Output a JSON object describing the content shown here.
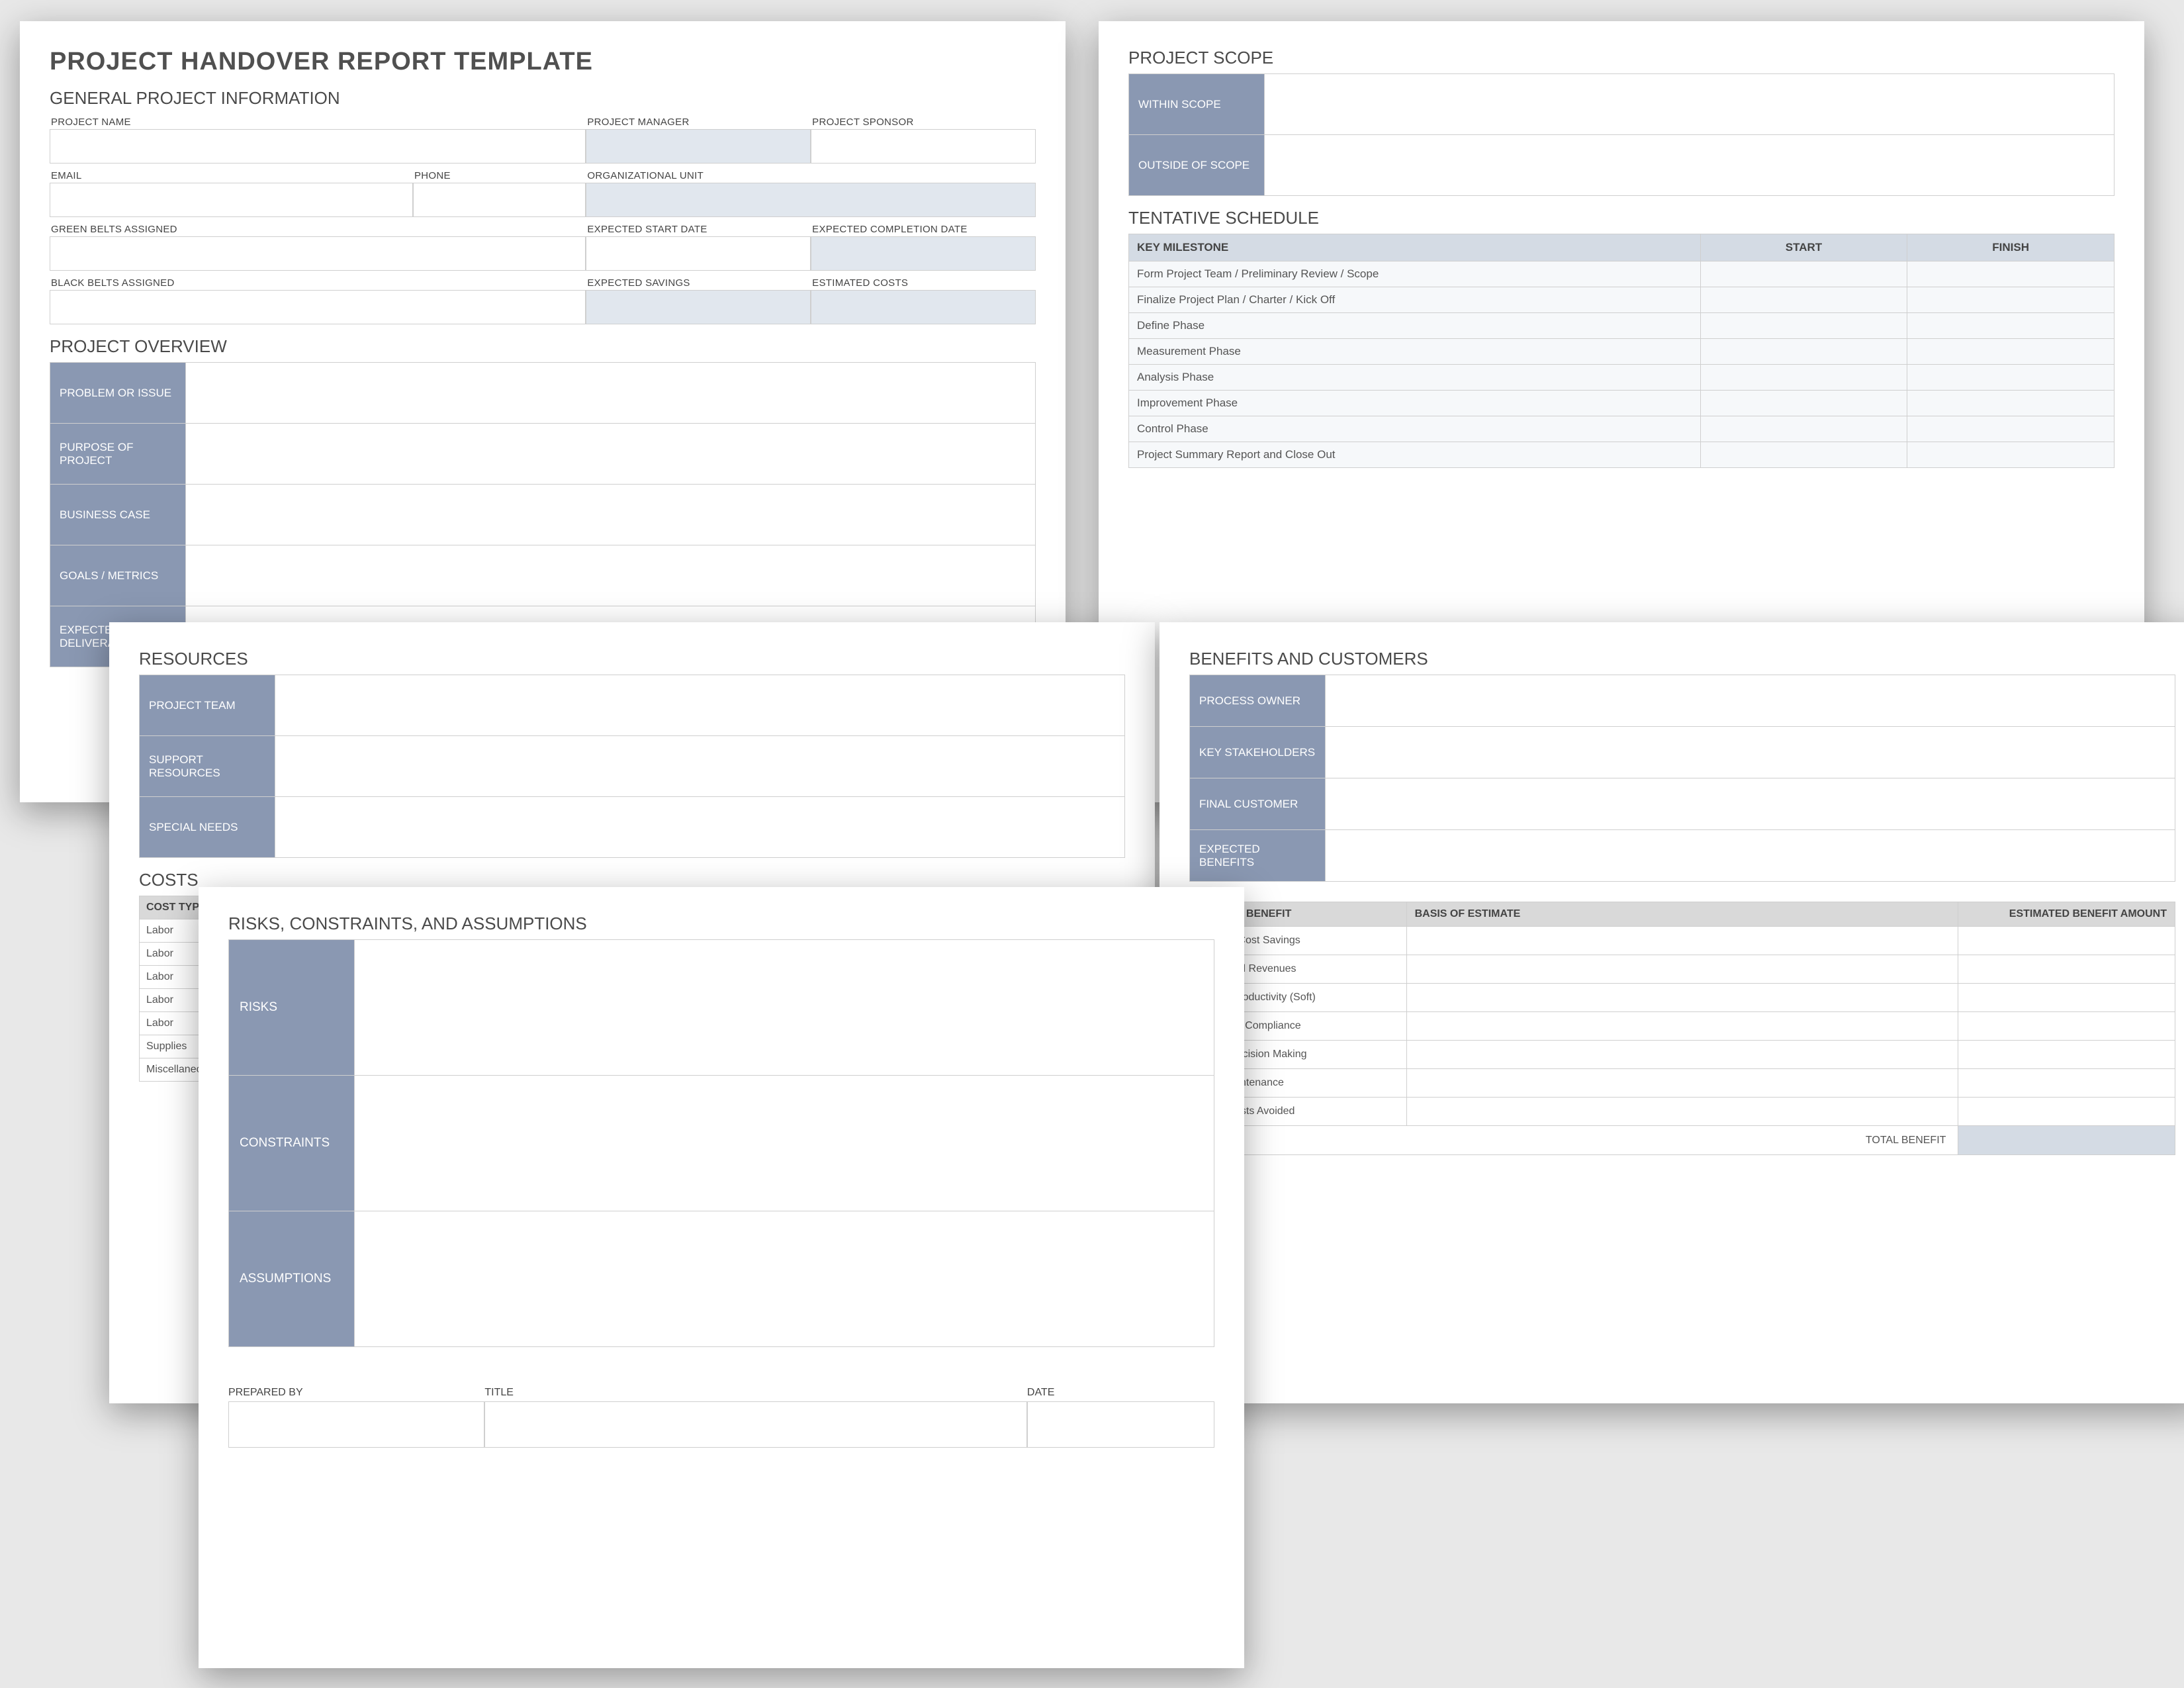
{
  "main_title": "PROJECT HANDOVER REPORT TEMPLATE",
  "sections": {
    "general_info": "GENERAL PROJECT INFORMATION",
    "project_overview": "PROJECT OVERVIEW",
    "project_scope": "PROJECT SCOPE",
    "tentative_schedule": "TENTATIVE SCHEDULE",
    "resources": "RESOURCES",
    "costs": "COSTS",
    "benefits_customers": "BENEFITS AND CUSTOMERS",
    "risks": "RISKS, CONSTRAINTS, AND ASSUMPTIONS"
  },
  "fields": {
    "project_name": "PROJECT NAME",
    "project_manager": "PROJECT MANAGER",
    "project_sponsor": "PROJECT SPONSOR",
    "email": "EMAIL",
    "phone": "PHONE",
    "org_unit": "ORGANIZATIONAL UNIT",
    "green_belts": "GREEN BELTS ASSIGNED",
    "expected_start": "EXPECTED START DATE",
    "expected_completion": "EXPECTED COMPLETION DATE",
    "black_belts": "BLACK BELTS ASSIGNED",
    "expected_savings": "EXPECTED SAVINGS",
    "estimated_costs": "ESTIMATED COSTS"
  },
  "overview_rows": [
    "PROBLEM OR ISSUE",
    "PURPOSE OF PROJECT",
    "BUSINESS CASE",
    "GOALS / METRICS",
    "EXPECTED DELIVERABLES"
  ],
  "scope_rows": [
    "WITHIN SCOPE",
    "OUTSIDE OF SCOPE"
  ],
  "schedule": {
    "headers": {
      "milestone": "KEY MILESTONE",
      "start": "START",
      "finish": "FINISH"
    },
    "rows": [
      "Form Project Team / Preliminary Review / Scope",
      "Finalize Project Plan / Charter / Kick Off",
      "Define Phase",
      "Measurement Phase",
      "Analysis Phase",
      "Improvement Phase",
      "Control Phase",
      "Project Summary Report and Close Out"
    ]
  },
  "resources_rows": [
    "PROJECT TEAM",
    "SUPPORT RESOURCES",
    "SPECIAL NEEDS"
  ],
  "costs": {
    "header": "COST TYPE",
    "rows": [
      "Labor",
      "Labor",
      "Labor",
      "Labor",
      "Labor",
      "Supplies",
      "Miscellaneous"
    ]
  },
  "benefits_rows": [
    "PROCESS OWNER",
    "KEY STAKEHOLDERS",
    "FINAL CUSTOMER",
    "EXPECTED BENEFITS"
  ],
  "benefit_table": {
    "headers": {
      "type": "TYPE OF BENEFIT",
      "basis": "BASIS OF ESTIMATE",
      "amount": "ESTIMATED BENEFIT AMOUNT"
    },
    "rows": [
      "Specific Cost Savings",
      "Enhanced Revenues",
      "Higher Productivity (Soft)",
      "Improved Compliance",
      "Better Decision Making",
      "Less Maintenance",
      "Other Costs Avoided"
    ],
    "total_label": "TOTAL BENEFIT"
  },
  "risks_rows": [
    "RISKS",
    "CONSTRAINTS",
    "ASSUMPTIONS"
  ],
  "signature": {
    "prepared_by": "PREPARED BY",
    "title": "TITLE",
    "date": "DATE"
  }
}
